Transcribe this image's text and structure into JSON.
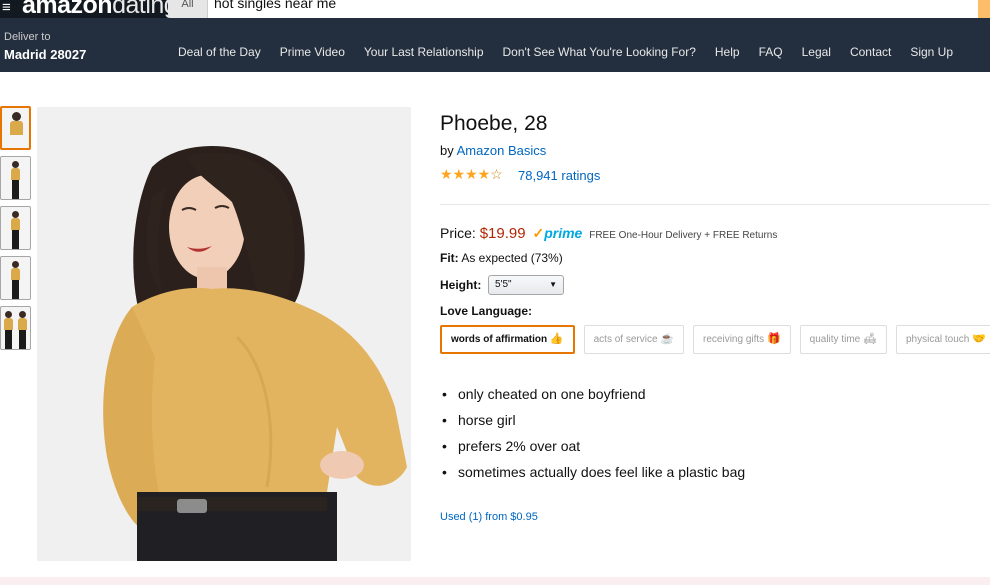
{
  "header": {
    "logo_amazon": "amazon",
    "logo_dating": "dating",
    "search_category": "All",
    "search_value": "hot singles near me",
    "deliver_to": "Deliver to",
    "deliver_location": "Madrid 28027",
    "nav_links": [
      "Deal of the Day",
      "Prime Video",
      "Your Last Relationship",
      "Don't See What You're Looking For?",
      "Help",
      "FAQ",
      "Legal",
      "Contact",
      "Sign Up"
    ]
  },
  "thumbnails": [
    "thumb-1",
    "thumb-2",
    "thumb-3",
    "thumb-4",
    "thumb-5"
  ],
  "product": {
    "title": "Phoebe, 28",
    "by_prefix": "by",
    "brand": "Amazon Basics",
    "stars": "★★★★",
    "star_empty": "☆",
    "ratings": "78,941 ratings",
    "rating_value": 4.0,
    "price_label": "Price:",
    "price": "$19.99",
    "prime_check": "✓",
    "prime": "prime",
    "delivery": "FREE One-Hour Delivery + FREE Returns",
    "fit_label": "Fit:",
    "fit_value": "As expected (73%)",
    "height_label": "Height:",
    "height_value": "5'5\"",
    "love_language_label": "Love Language:",
    "love_languages": [
      {
        "label": "words of affirmation",
        "emoji": "👍"
      },
      {
        "label": "acts of service",
        "emoji": "☕"
      },
      {
        "label": "receiving gifts",
        "emoji": "🎁"
      },
      {
        "label": "quality time",
        "emoji": "🛋"
      },
      {
        "label": "physical touch",
        "emoji": "🤝"
      }
    ],
    "bullets": [
      "only cheated on one boyfriend",
      "horse girl",
      "prefers 2% over oat",
      "sometimes actually does feel like a plastic bag"
    ],
    "used_offer": "Used (1) from $0.95"
  },
  "colors": {
    "nav_dark": "#131921",
    "nav": "#232f3e",
    "link": "#0066c0",
    "price": "#b12704",
    "accent": "#e77600",
    "star": "#ffa41c"
  }
}
